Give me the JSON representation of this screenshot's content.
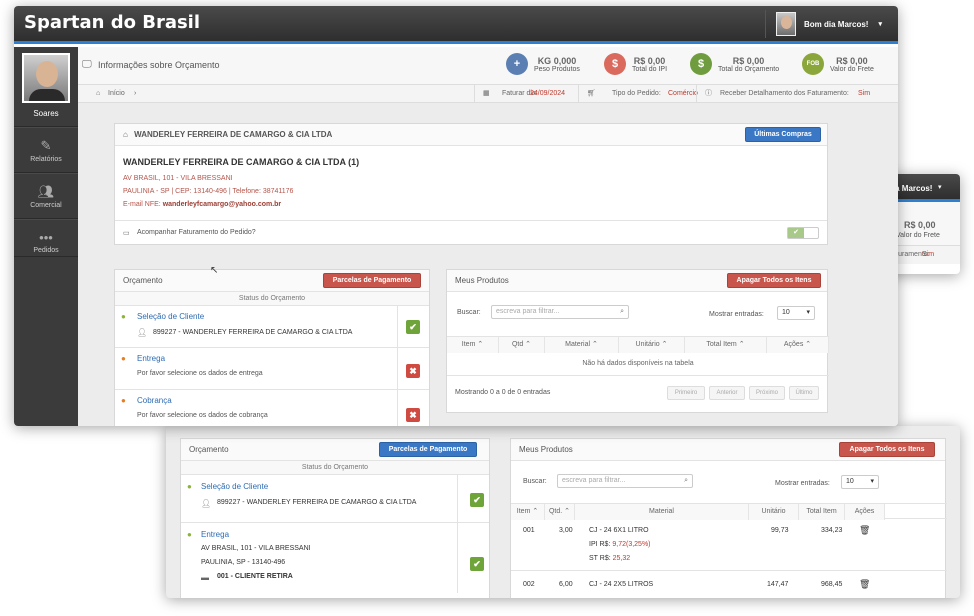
{
  "app": {
    "brand": "Spartan do Brasil",
    "greeting": "Bom dia Marcos!",
    "greeting_short": "dia Marcos!"
  },
  "sidebar": {
    "user_name": "Soares",
    "items": [
      {
        "label": "Relatórios",
        "icon": "edit-icon"
      },
      {
        "label": "Comercial",
        "icon": "users-icon"
      },
      {
        "label": "Pedidos",
        "icon": "dots-icon"
      }
    ]
  },
  "info": {
    "title": "Informações sobre Orçamento",
    "stats": [
      {
        "value": "KG 0,000",
        "label": "Peso Produtos",
        "glyph": "+",
        "color": "#5b7fb3"
      },
      {
        "value": "R$ 0,00",
        "label": "Total do IPI",
        "glyph": "$",
        "color": "#d96a5d"
      },
      {
        "value": "R$ 0,00",
        "label": "Total do Orçamento",
        "glyph": "$",
        "color": "#6f9c3e"
      },
      {
        "value": "R$ 0,00",
        "label": "Valor do Frete",
        "glyph": "FOB",
        "color": "#8ba73c"
      }
    ]
  },
  "breadcrumb": {
    "home": "Início",
    "faturar_label": "Faturar dia:",
    "faturar_value": "24/09/2024",
    "tipo_label": "Tipo do Pedido:",
    "tipo_value": "Comércio",
    "receber_label": "Receber Detalhamento dos Faturamento:",
    "receber_value": "Sim",
    "receber_label_short": "Faturamento:"
  },
  "customer": {
    "header_name": "WANDERLEY FERREIRA DE CAMARGO & CIA LTDA",
    "btn_ultimas": "Últimas Compras",
    "name": "WANDERLEY FERREIRA DE CAMARGO & CIA LTDA (1)",
    "address": "AV BRASIL, 101 - VILA BRESSANI",
    "city": "PAULINIA - SP | CEP: 13140-496 | Telefone: 38741176",
    "email_label": "E-mail NFE:",
    "email": "wanderleyfcamargo@yahoo.com.br",
    "acompanhar": "Acompanhar Faturamento do Pedido?"
  },
  "orcamento": {
    "title": "Orçamento",
    "btn_parcelas": "Parcelas de Pagamento",
    "status_header": "Status do Orçamento",
    "cliente_title": "Seleção de Cliente",
    "cliente_value": "899227 - WANDERLEY FERREIRA DE CAMARGO & CIA LTDA",
    "entrega_title": "Entrega",
    "entrega_msg": "Por favor selecione os dados de entrega",
    "cobranca_title": "Cobrança",
    "cobranca_msg": "Por favor selecione os dados de cobrança",
    "entrega_addr1": "AV BRASIL, 101 - VILA BRESSANI",
    "entrega_addr2": "PAULINIA, SP - 13140-496",
    "entrega_retira": "001 - CLIENTE RETIRA"
  },
  "produtos": {
    "title": "Meus Produtos",
    "btn_apagar": "Apagar Todos os Itens",
    "buscar_label": "Buscar:",
    "buscar_placeholder": "escreva para filtrar...",
    "mostrar_label": "Mostrar entradas:",
    "mostrar_value": "10",
    "cols": [
      "Item",
      "Qtd",
      "Material",
      "Unitário",
      "Total Item",
      "Ações"
    ],
    "cols_b": [
      "Item",
      "Qtd.",
      "Material",
      "Unitário",
      "Total Item",
      "Ações"
    ],
    "empty": "Não há dados disponíveis na tabela",
    "footer": "Mostrando 0 a 0 de 0 entradas",
    "pag": [
      "Primeiro",
      "Anterior",
      "Próximo",
      "Último"
    ],
    "rows": [
      {
        "item": "001",
        "qtd": "3,00",
        "material": "CJ - 24 6X1 LITRO",
        "ipi_label": "IPI R$:",
        "ipi": "9,72(3,25%)",
        "st_label": "ST R$:",
        "st": "25,32",
        "unit": "99,73",
        "total": "334,23"
      },
      {
        "item": "002",
        "qtd": "6,00",
        "material": "CJ - 24 2X5 LITROS",
        "unit": "147,47",
        "total": "968,45"
      }
    ]
  }
}
